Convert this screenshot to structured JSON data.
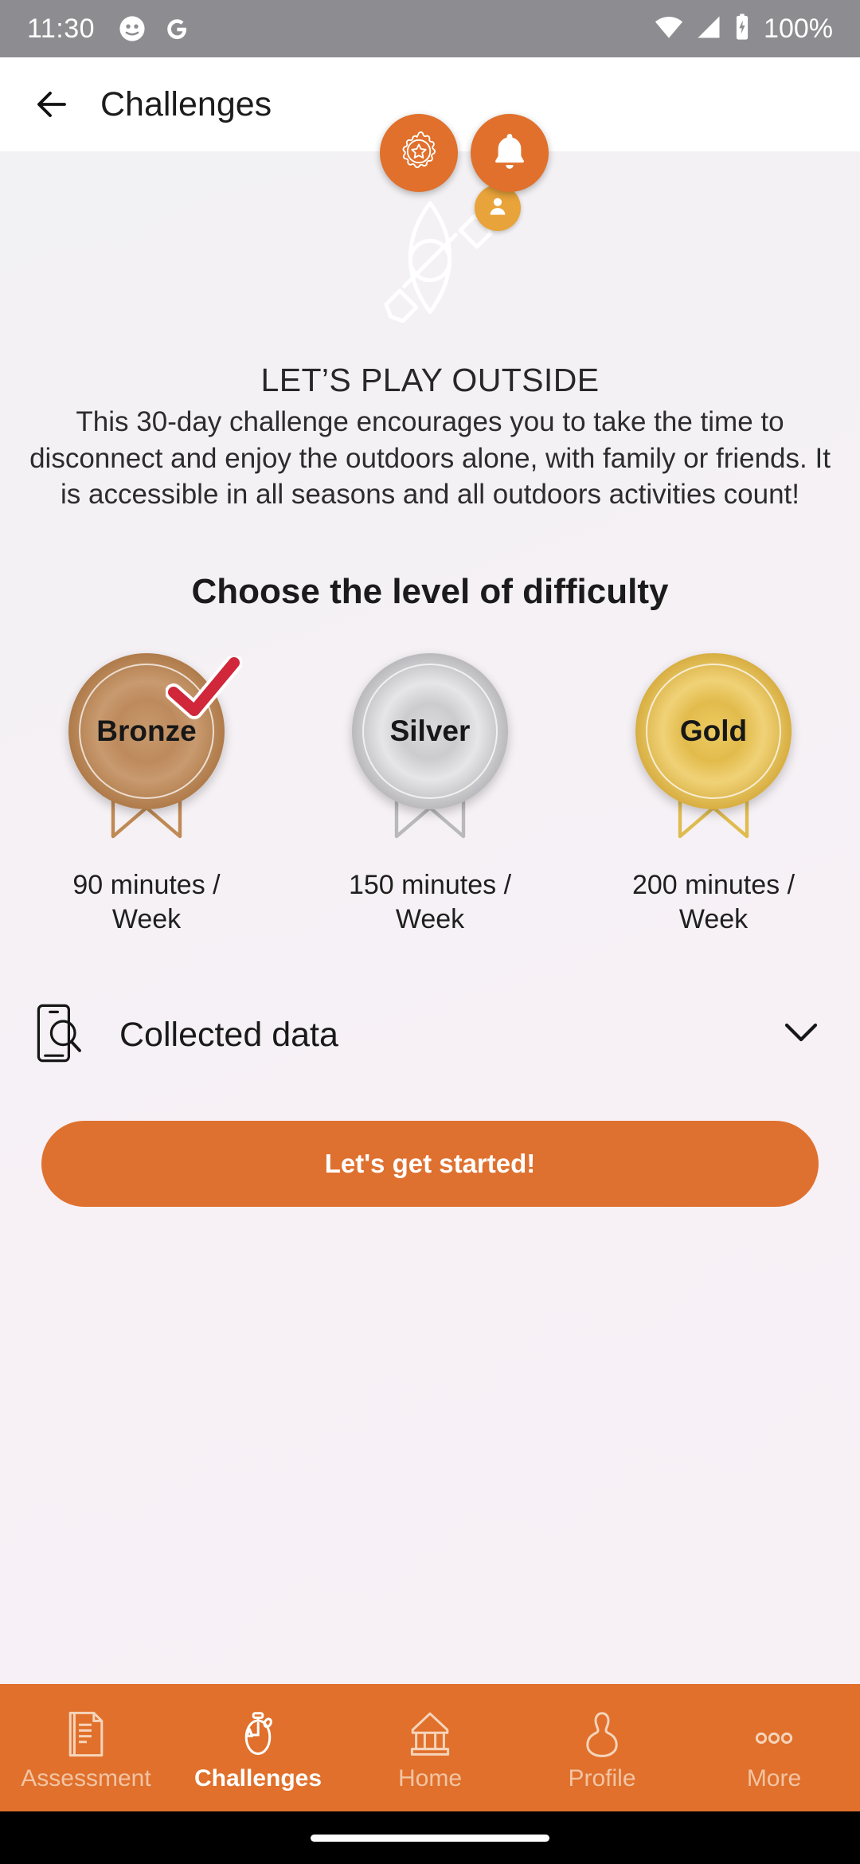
{
  "statusbar": {
    "time": "11:30",
    "battery_text": "100%",
    "icons": [
      "face-app-icon",
      "google-icon",
      "wifi-icon",
      "cellular-signal-icon",
      "battery-charging-icon"
    ]
  },
  "appbar": {
    "title": "Challenges",
    "back_icon": "arrow-left-icon"
  },
  "fabs": [
    {
      "name": "rewards-badge-fab",
      "icon": "star-rosette-icon"
    },
    {
      "name": "notifications-fab",
      "icon": "bell-icon"
    }
  ],
  "hero": {
    "illustration": "kayak-paddle-icon",
    "avatar_badge_icon": "person-icon"
  },
  "challenge": {
    "title": "LET’S PLAY OUTSIDE",
    "description": "This 30-day challenge encourages you to take the time to disconnect and enjoy the outdoors alone, with family or friends. It is accessible in all seasons and all outdoors activities count!"
  },
  "difficulty": {
    "heading": "Choose the level of difficulty",
    "levels": [
      {
        "label": "Bronze",
        "minutes": "90 minutes / Week",
        "selected": true,
        "check_icon": "red-check-icon"
      },
      {
        "label": "Silver",
        "minutes": "150 minutes / Week",
        "selected": false,
        "check_icon": ""
      },
      {
        "label": "Gold",
        "minutes": "200 minutes / Week",
        "selected": false,
        "check_icon": ""
      }
    ]
  },
  "collected_data": {
    "label": "Collected data",
    "leading_icon": "phone-search-icon",
    "expand_icon": "chevron-down-icon"
  },
  "cta": {
    "label": "Let's get started!"
  },
  "bottomnav": {
    "items": [
      {
        "label": "Assessment",
        "icon": "document-lines-icon",
        "active": false
      },
      {
        "label": "Challenges",
        "icon": "stopwatch-icon",
        "active": true
      },
      {
        "label": "Home",
        "icon": "house-icon",
        "active": false
      },
      {
        "label": "Profile",
        "icon": "person-outline-icon",
        "active": false
      },
      {
        "label": "More",
        "icon": "three-dots-icon",
        "active": false
      }
    ]
  },
  "colors": {
    "accent_orange": "#e0702b",
    "cta_orange": "#df7130",
    "status_gray": "#8d8d91",
    "body_bg": "#f4f1f4",
    "avatar_amber": "#e8a33a",
    "check_red": "#d0273a"
  }
}
